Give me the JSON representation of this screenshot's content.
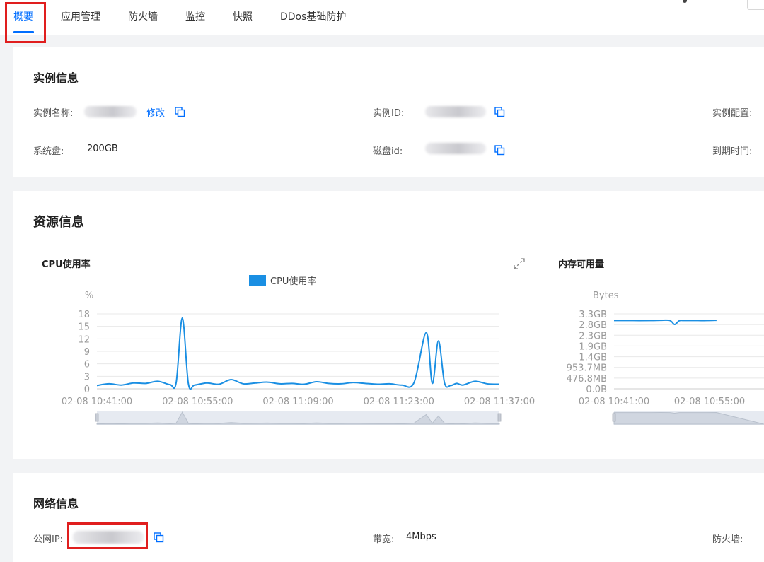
{
  "tabs": [
    {
      "label": "概要",
      "active": true
    },
    {
      "label": "应用管理",
      "active": false
    },
    {
      "label": "防火墙",
      "active": false
    },
    {
      "label": "监控",
      "active": false
    },
    {
      "label": "快照",
      "active": false
    },
    {
      "label": "DDos基础防护",
      "active": false
    }
  ],
  "instance": {
    "title": "实例信息",
    "name_label": "实例名称:",
    "edit_link": "修改",
    "id_label": "实例ID:",
    "config_label": "实例配置:",
    "disk_label": "系统盘:",
    "disk_value": "200GB",
    "disk_id_label": "磁盘id:",
    "expire_label": "到期时间:"
  },
  "resources": {
    "title": "资源信息",
    "cpu_chart_title": "CPU使用率",
    "mem_chart_title": "内存可用量"
  },
  "network": {
    "title": "网络信息",
    "ip_label": "公网IP:",
    "bandwidth_label": "带宽:",
    "bandwidth_value": "4Mbps",
    "firewall_label": "防火墙:"
  },
  "colors": {
    "accent": "#006eff",
    "series": "#1a8fe3",
    "highlight": "#e01e1e"
  },
  "chart_data": [
    {
      "type": "line",
      "title": "CPU使用率",
      "legend": [
        "CPU使用率"
      ],
      "ylabel": "%",
      "ylim": [
        0,
        18
      ],
      "yticks": [
        "0",
        "3",
        "6",
        "9",
        "12",
        "15",
        "18"
      ],
      "xticks": [
        "02-08 10:41:00",
        "02-08 10:55:00",
        "02-08 11:09:00",
        "02-08 11:23:00",
        "02-08 11:37:00"
      ],
      "x_minutes": [
        0,
        2,
        4,
        6,
        8,
        10,
        12,
        13,
        14,
        15,
        16,
        18,
        20,
        22,
        24,
        26,
        28,
        30,
        32,
        34,
        36,
        38,
        40,
        42,
        44,
        46,
        48,
        50,
        52,
        54,
        55,
        56,
        57,
        58,
        59,
        60,
        62,
        64,
        66
      ],
      "series": [
        {
          "values": [
            0.8,
            1.2,
            0.9,
            1.4,
            1.3,
            1.8,
            1.0,
            1.5,
            17.0,
            1.2,
            0.9,
            1.4,
            1.1,
            2.2,
            1.2,
            1.4,
            1.6,
            1.2,
            1.3,
            1.1,
            1.7,
            1.3,
            1.2,
            1.5,
            1.3,
            1.1,
            1.2,
            0.9,
            1.5,
            13.5,
            1.3,
            11.5,
            1.4,
            0.8,
            1.3,
            0.9,
            1.8,
            1.2,
            1.1
          ]
        }
      ]
    },
    {
      "type": "line",
      "title": "内存可用量",
      "ylabel": "Bytes",
      "yticks": [
        "0.0B",
        "476.8MB",
        "953.7MB",
        "1.4GB",
        "1.9GB",
        "2.3GB",
        "2.8GB",
        "3.3GB"
      ],
      "ylim_gb": [
        0,
        3.26
      ],
      "xticks": [
        "02-08 10:41:00",
        "02-08 10:55:00"
      ],
      "x_minutes": [
        0,
        4,
        8,
        10,
        12,
        13,
        14,
        15,
        16,
        18,
        20,
        22
      ],
      "series": [
        {
          "values_gb": [
            2.97,
            2.97,
            2.97,
            2.98,
            2.97,
            2.8,
            2.96,
            2.97,
            2.97,
            2.97,
            2.97,
            2.98
          ]
        }
      ]
    }
  ]
}
